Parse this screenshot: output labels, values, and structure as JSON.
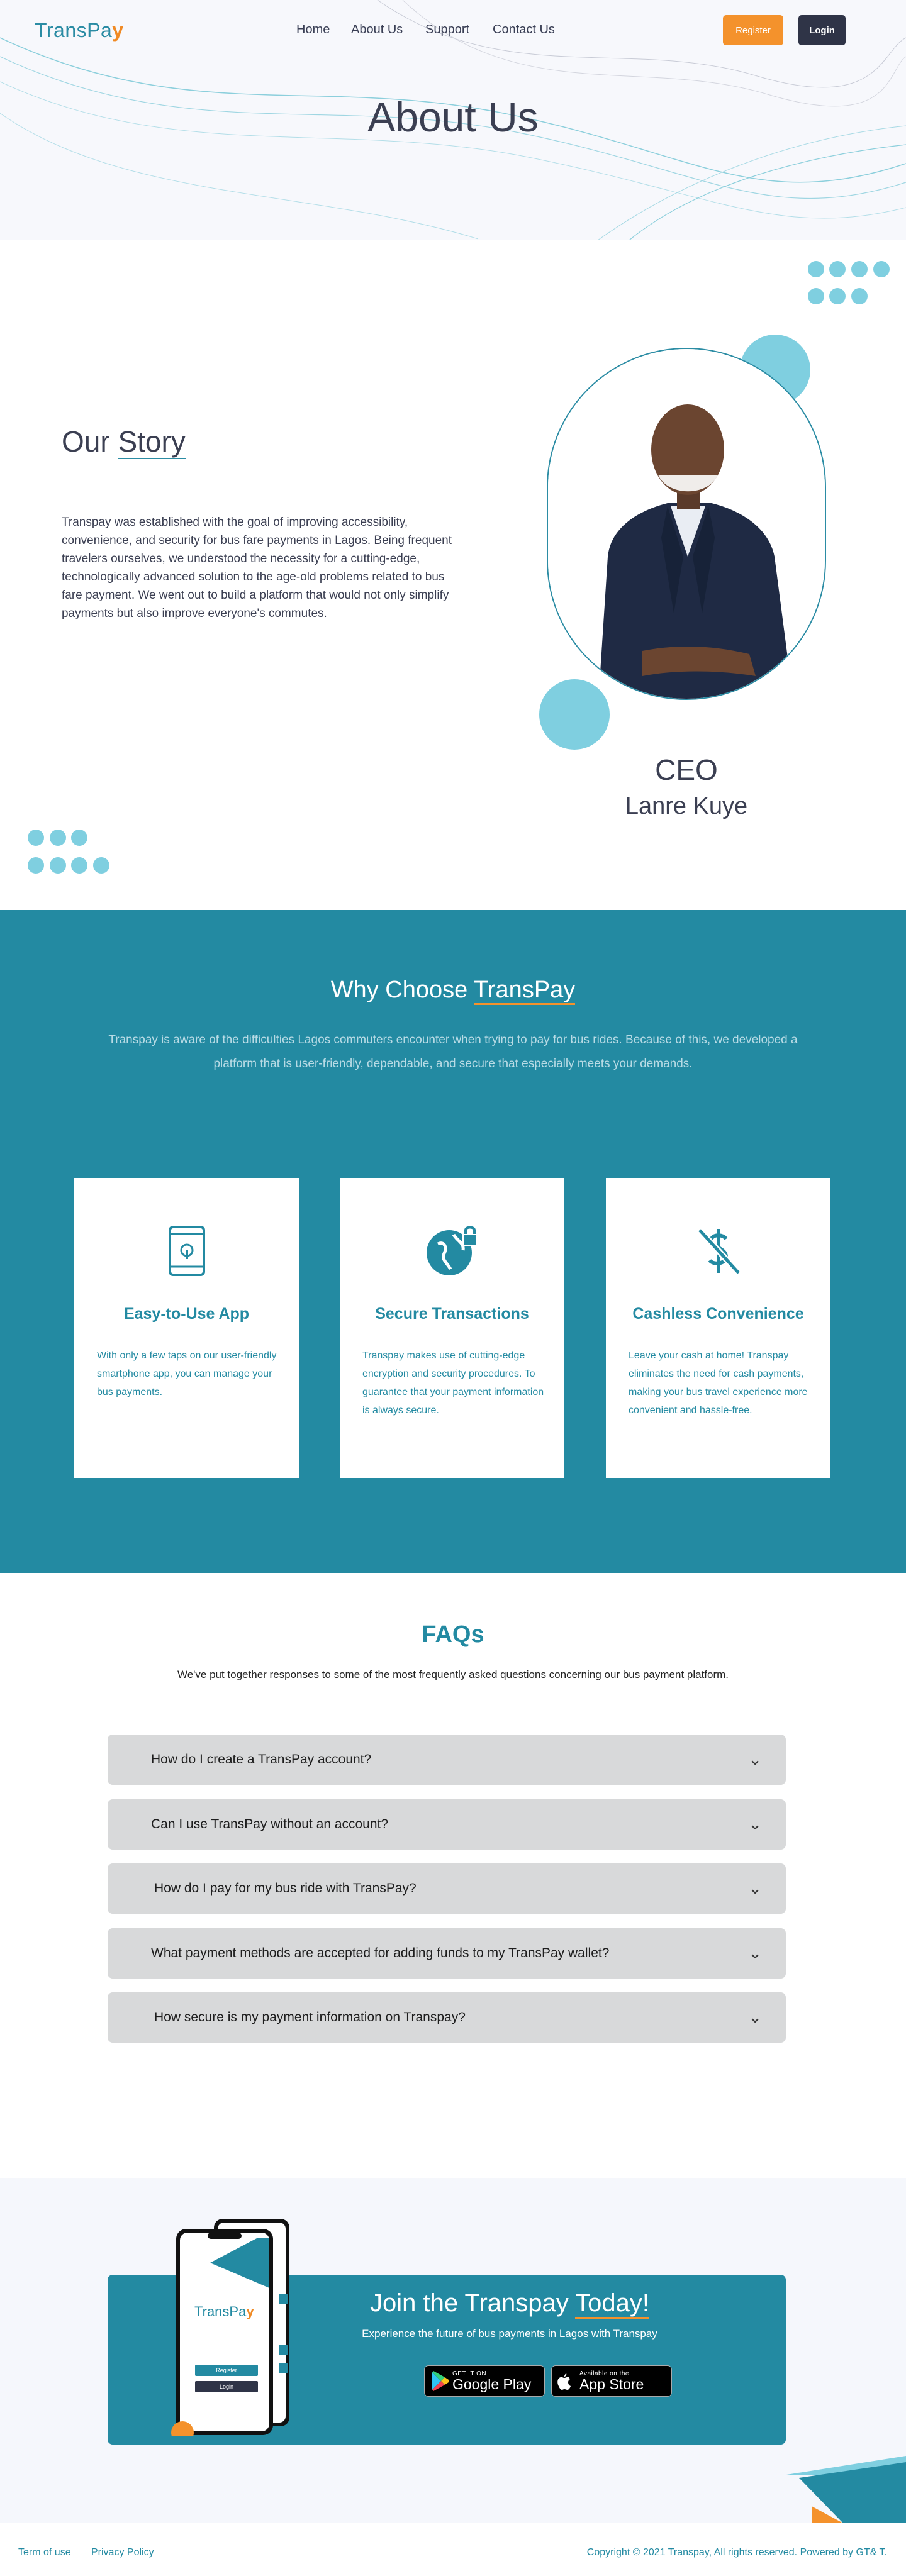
{
  "header": {
    "logo": {
      "text_main": "TransPa",
      "text_accent": "y"
    },
    "nav": [
      "Home",
      "About Us",
      "Support",
      "Contact Us"
    ],
    "register_label": "Register",
    "login_label": "Login"
  },
  "hero": {
    "title": "About Us"
  },
  "story": {
    "title_prefix": "Our ",
    "title_emph": "Story",
    "paragraph": "Transpay was established with the goal of improving accessibility, convenience, and security for bus fare payments in Lagos. Being frequent travelers ourselves, we understood the necessity for a cutting-edge, technologically advanced solution to the age-old problems related to bus fare payment. We went out to build a platform that would not only simplify payments but also improve everyone's commutes.",
    "ceo_role": "CEO",
    "ceo_name": "Lanre Kuye"
  },
  "why": {
    "title_prefix": "Why Choose ",
    "title_emph": "TransPay",
    "description": "Transpay is aware of the difficulties Lagos commuters encounter when trying to pay for bus rides. Because of this, we developed a platform that is user-friendly, dependable, and secure that especially meets your demands.",
    "cards": [
      {
        "icon": "phone-icon",
        "title": "Easy-to-Use App",
        "text": "With only a few taps on our user-friendly smartphone app, you can manage your bus payments."
      },
      {
        "icon": "globe-lock-icon",
        "title": "Secure Transactions",
        "text": "Transpay makes use of cutting-edge encryption and security procedures. To guarantee that your payment information is always secure."
      },
      {
        "icon": "no-cash-icon",
        "title": "Cashless Convenience",
        "text": "Leave your cash at home! Transpay eliminates the need for cash payments, making your bus travel experience more convenient and hassle-free."
      }
    ]
  },
  "faq": {
    "title": "FAQs",
    "subtitle": "We've put together responses to some of the most frequently asked questions concerning our bus payment platform.",
    "items": [
      "How do I create a TransPay account?",
      "Can I use TransPay without an account?",
      "How do I pay for my bus ride with TransPay?",
      "What payment methods are accepted for adding funds to my TransPay wallet?",
      "How secure is my payment information on Transpay?"
    ]
  },
  "join": {
    "title_prefix": "Join the Transpay ",
    "title_emph": "Today!",
    "subtitle": "Experience the future of bus payments in Lagos with Transpay",
    "google_small": "GET IT ON",
    "google_big": "Google Play",
    "apple_small": "Available on the",
    "apple_big": "App Store",
    "phone_logo_main": "TransPa",
    "phone_logo_accent": "y",
    "phone_btn1": "Register",
    "phone_btn2": "Login"
  },
  "footer": {
    "terms": "Term of use",
    "privacy": "Privacy Policy",
    "copyright": "Copyright © 2021 Transpay, All rights reserved. Powered by  GT& T."
  },
  "colors": {
    "primary": "#238aa2",
    "accent": "#f4922c",
    "dark": "#2f3447",
    "light_blue": "#7fcfe0"
  }
}
